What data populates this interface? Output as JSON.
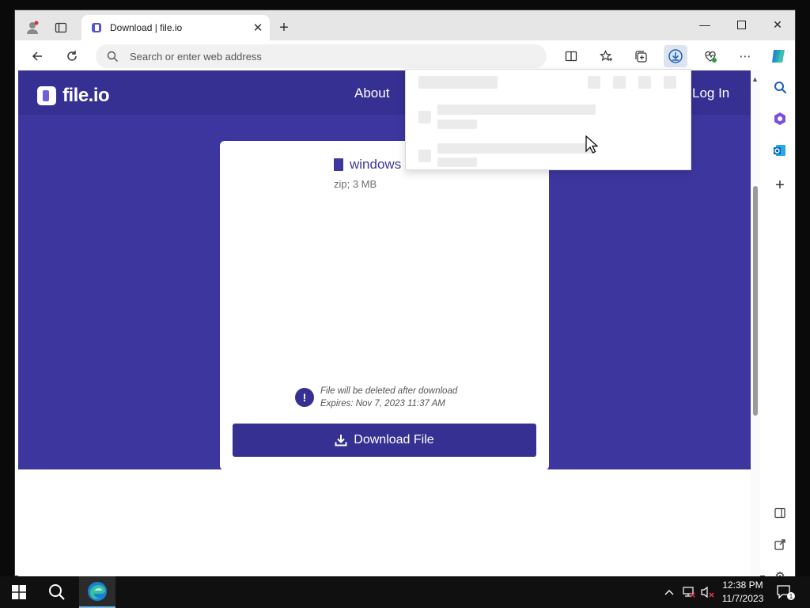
{
  "browser": {
    "tab_title": "Download | file.io",
    "address_placeholder": "Search or enter web address"
  },
  "site": {
    "logo_text": "file.io",
    "nav": {
      "about": "About",
      "login": "Log In"
    },
    "file": {
      "name": "windows",
      "meta": "zip; 3 MB"
    },
    "notice": {
      "line1": "File will be deleted after download",
      "line2": "Expires: Nov 7, 2023 11:37 AM"
    },
    "download_button": "Download File"
  },
  "taskbar": {
    "time": "12:38 PM",
    "date": "11/7/2023",
    "notification_count": "1"
  },
  "colors": {
    "brand_primary": "#363092",
    "brand_body": "#3d369f"
  }
}
